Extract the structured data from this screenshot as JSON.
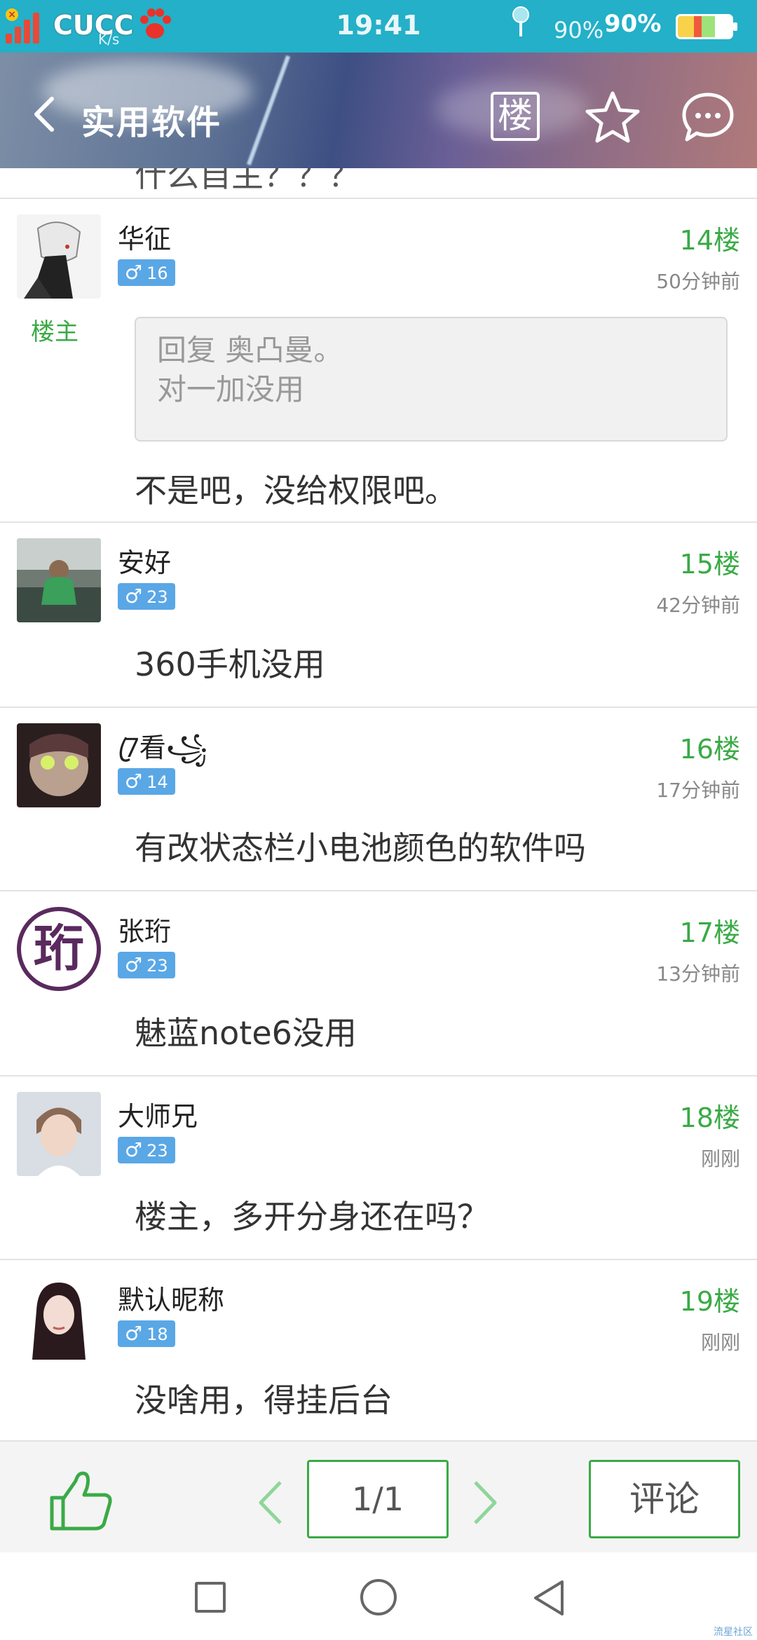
{
  "status_bar": {
    "carrier": "CUCC",
    "net_speed": "K/s",
    "time": "19:41",
    "battery_text": "90%",
    "battery_text_bold": "90%"
  },
  "nav": {
    "title": "实用软件",
    "floor_label": "楼"
  },
  "previous_post_tail": "什么自主？？？",
  "posts": [
    {
      "username": "华征",
      "gender_symbol": "♂",
      "level": "16",
      "floor": "14楼",
      "time": "50分钟前",
      "owner_tag": "楼主",
      "quote_line1": "回复 奥凸曼。",
      "quote_line2": "对一加没用",
      "body": "不是吧，没给权限吧。"
    },
    {
      "username": "安好",
      "gender_symbol": "♂",
      "level": "23",
      "floor": "15楼",
      "time": "42分钟前",
      "body": "360手机没用"
    },
    {
      "username": "7ꦿ看꧁",
      "gender_symbol": "♂",
      "level": "14",
      "floor": "16楼",
      "time": "17分钟前",
      "body": "有改状态栏小电池颜色的软件吗"
    },
    {
      "username": "张珩",
      "gender_symbol": "♂",
      "level": "23",
      "floor": "17楼",
      "time": "13分钟前",
      "body": "魅蓝note6没用",
      "avatar_glyph": "珩"
    },
    {
      "username": "大师兄",
      "gender_symbol": "♂",
      "level": "23",
      "floor": "18楼",
      "time": "刚刚",
      "body": "楼主，多开分身还在吗？"
    },
    {
      "username": "默认昵称",
      "gender_symbol": "♂",
      "level": "18",
      "floor": "19楼",
      "time": "刚刚",
      "body": "没啥用，得挂后台"
    }
  ],
  "action_bar": {
    "page_indicator": "1/1",
    "comment_label": "评论"
  },
  "watermark": "流星社区",
  "colors": {
    "accent_green": "#3aaa46",
    "status_bar_bg": "#23b0c8",
    "badge_blue": "#5aa7e6"
  },
  "icons": [
    "back-arrow-icon",
    "floor-icon",
    "star-icon",
    "chat-bubble-icon",
    "thumbs-up-icon",
    "chevron-left-icon",
    "chevron-right-icon",
    "recent-apps-icon",
    "home-icon",
    "back-triangle-icon"
  ]
}
